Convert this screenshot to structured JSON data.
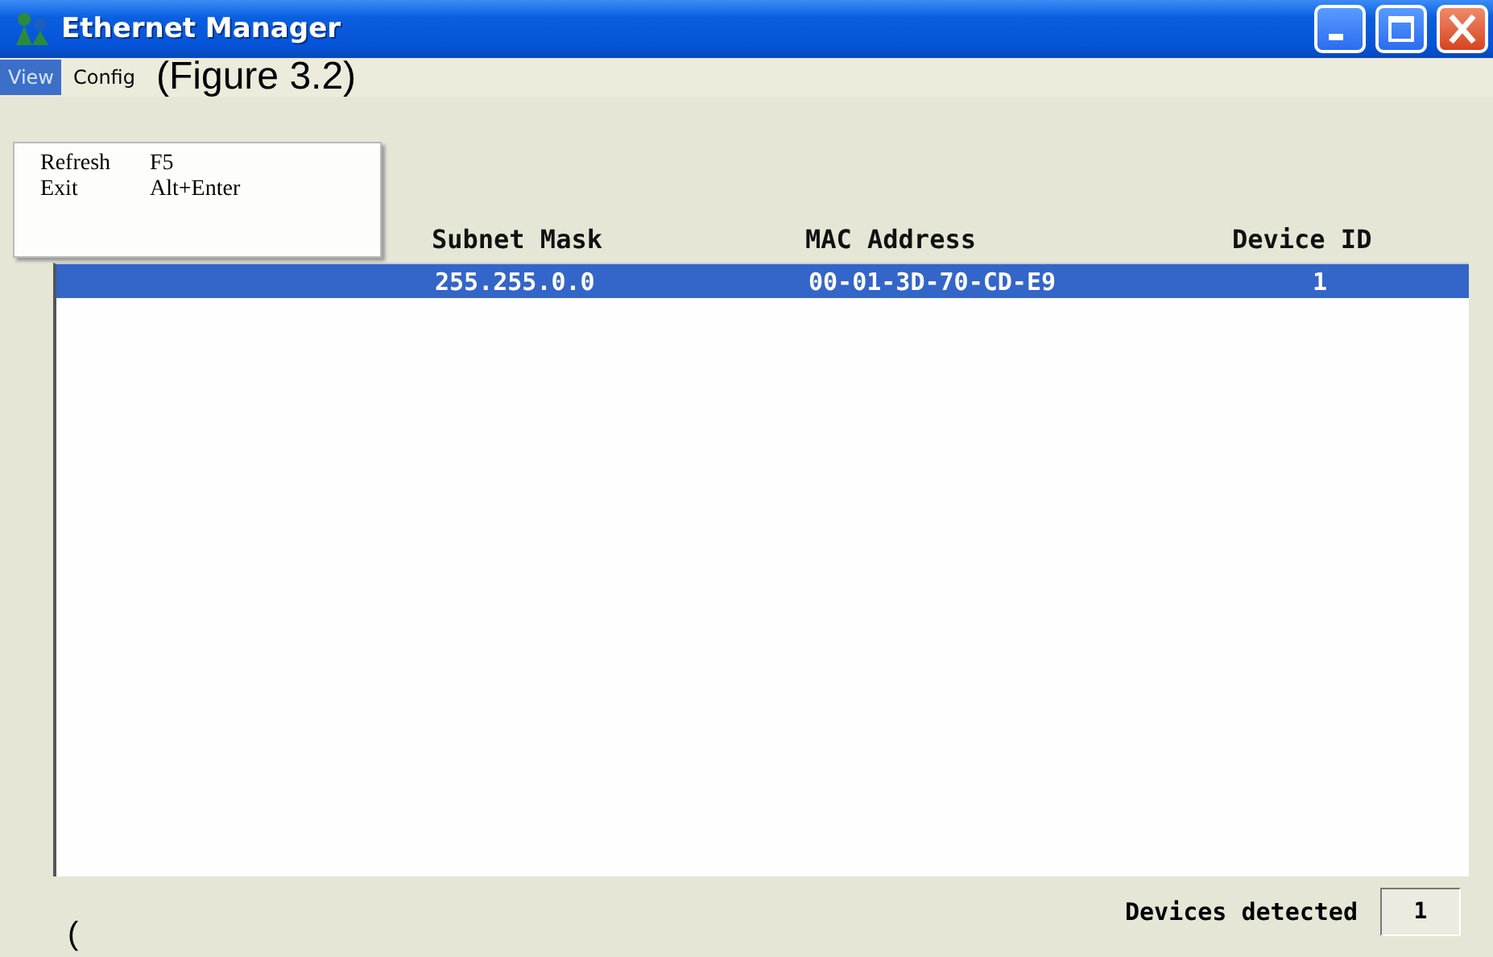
{
  "window": {
    "title": "Ethernet Manager"
  },
  "menu_bar": [
    {
      "label": "View",
      "selected": true
    },
    {
      "label": "Config",
      "selected": false
    }
  ],
  "figure_caption": "(Figure 3.2)",
  "open_menu": [
    {
      "label": "Refresh",
      "shortcut": "F5"
    },
    {
      "label": "Exit",
      "shortcut": "Alt+Enter"
    }
  ],
  "table": {
    "columns": [
      "Subnet Mask",
      "MAC Address",
      "Device ID"
    ],
    "rows": [
      {
        "cells": [
          "255.255.0.0",
          "00-01-3D-70-CD-E9",
          "1"
        ],
        "selected": true
      }
    ]
  },
  "status_bar": {
    "label": "Devices detected",
    "value": "1"
  },
  "caption_fragment": "("
}
